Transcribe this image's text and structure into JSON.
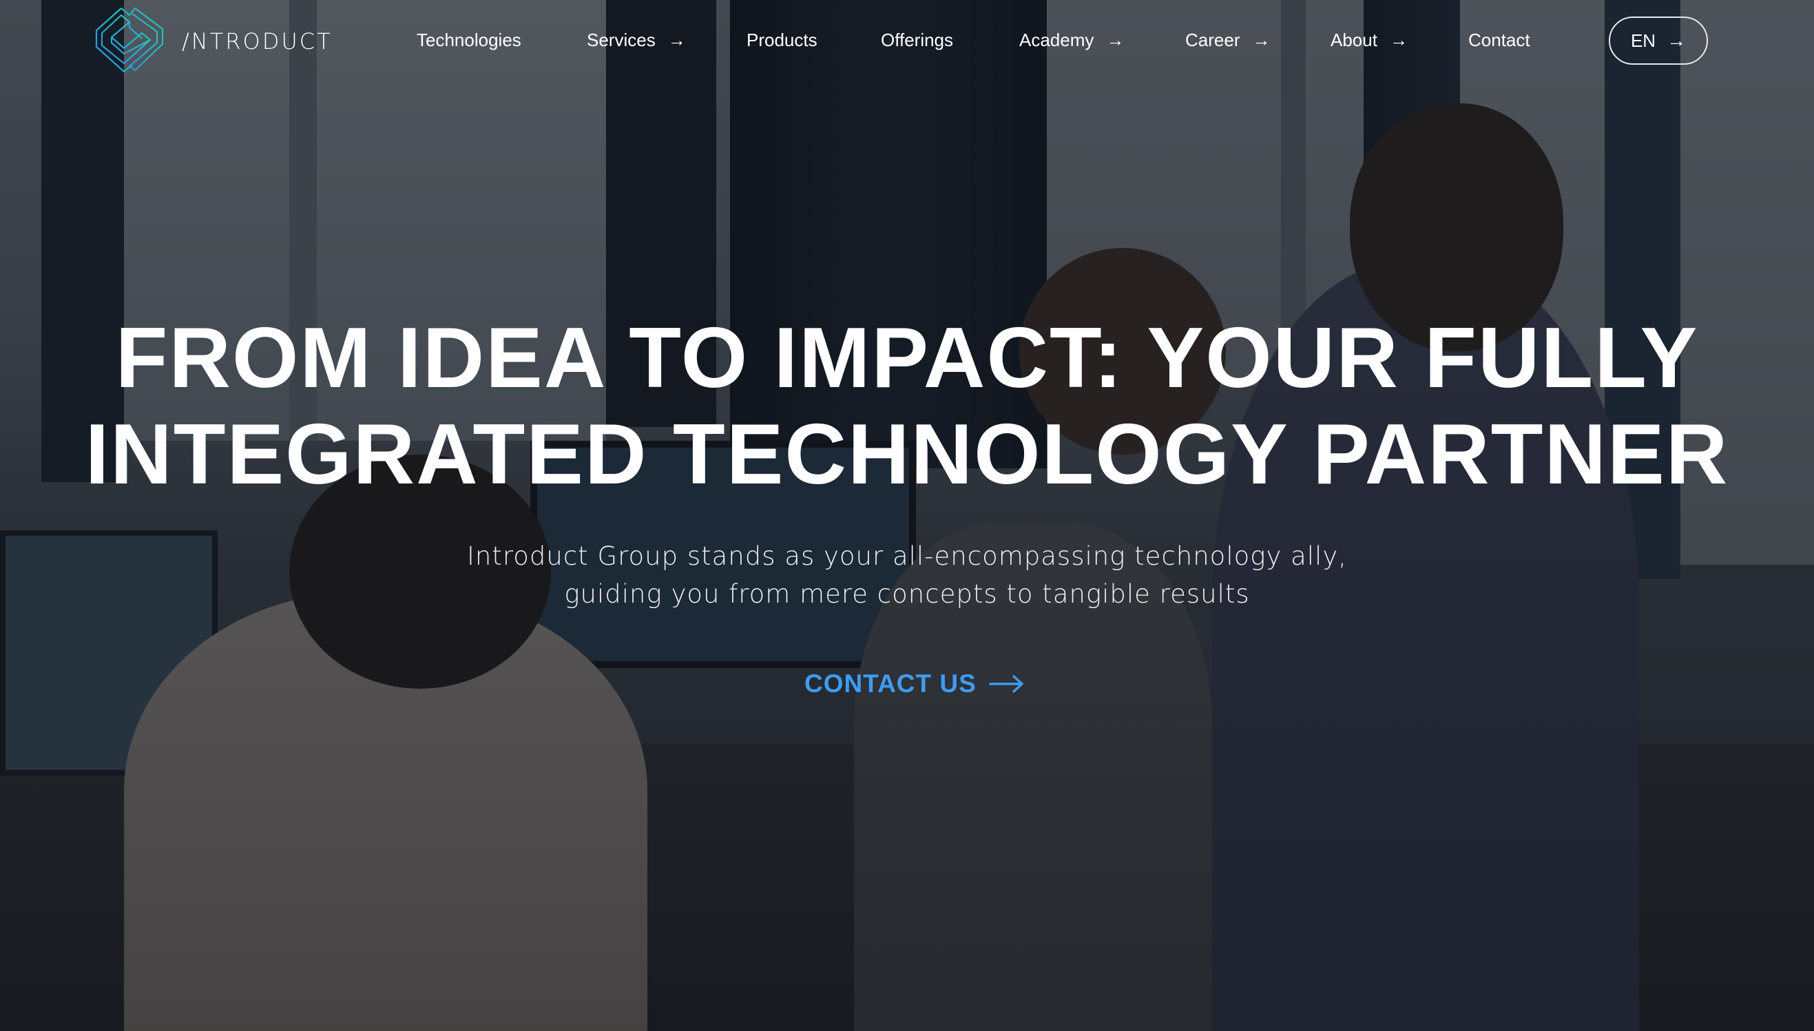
{
  "brand": {
    "name": "/NTRODUCT",
    "logo_icon": "introduct-logo-icon",
    "gradient_colors": [
      "#2aa8e8",
      "#1fc7b0"
    ]
  },
  "nav": {
    "items": [
      {
        "label": "Technologies",
        "has_arrow": false
      },
      {
        "label": "Services",
        "has_arrow": true
      },
      {
        "label": "Products",
        "has_arrow": false
      },
      {
        "label": "Offerings",
        "has_arrow": false
      },
      {
        "label": "Academy",
        "has_arrow": true
      },
      {
        "label": "Career",
        "has_arrow": true
      },
      {
        "label": "About",
        "has_arrow": true
      },
      {
        "label": "Contact",
        "has_arrow": false
      }
    ],
    "arrow_glyph": "→"
  },
  "language": {
    "label": "EN",
    "icon": "arrow-right-icon",
    "glyph": "→"
  },
  "hero": {
    "title_line1": "FROM IDEA TO IMPACT: YOUR FULLY",
    "title_line2": "INTEGRATED TECHNOLOGY PARTNER",
    "subtitle_line1": "Introduct Group stands as your all-encompassing technology ally,",
    "subtitle_line2": "guiding you from mere concepts to tangible results",
    "cta_label": "CONTACT US",
    "cta_color": "#3e9cf2"
  }
}
